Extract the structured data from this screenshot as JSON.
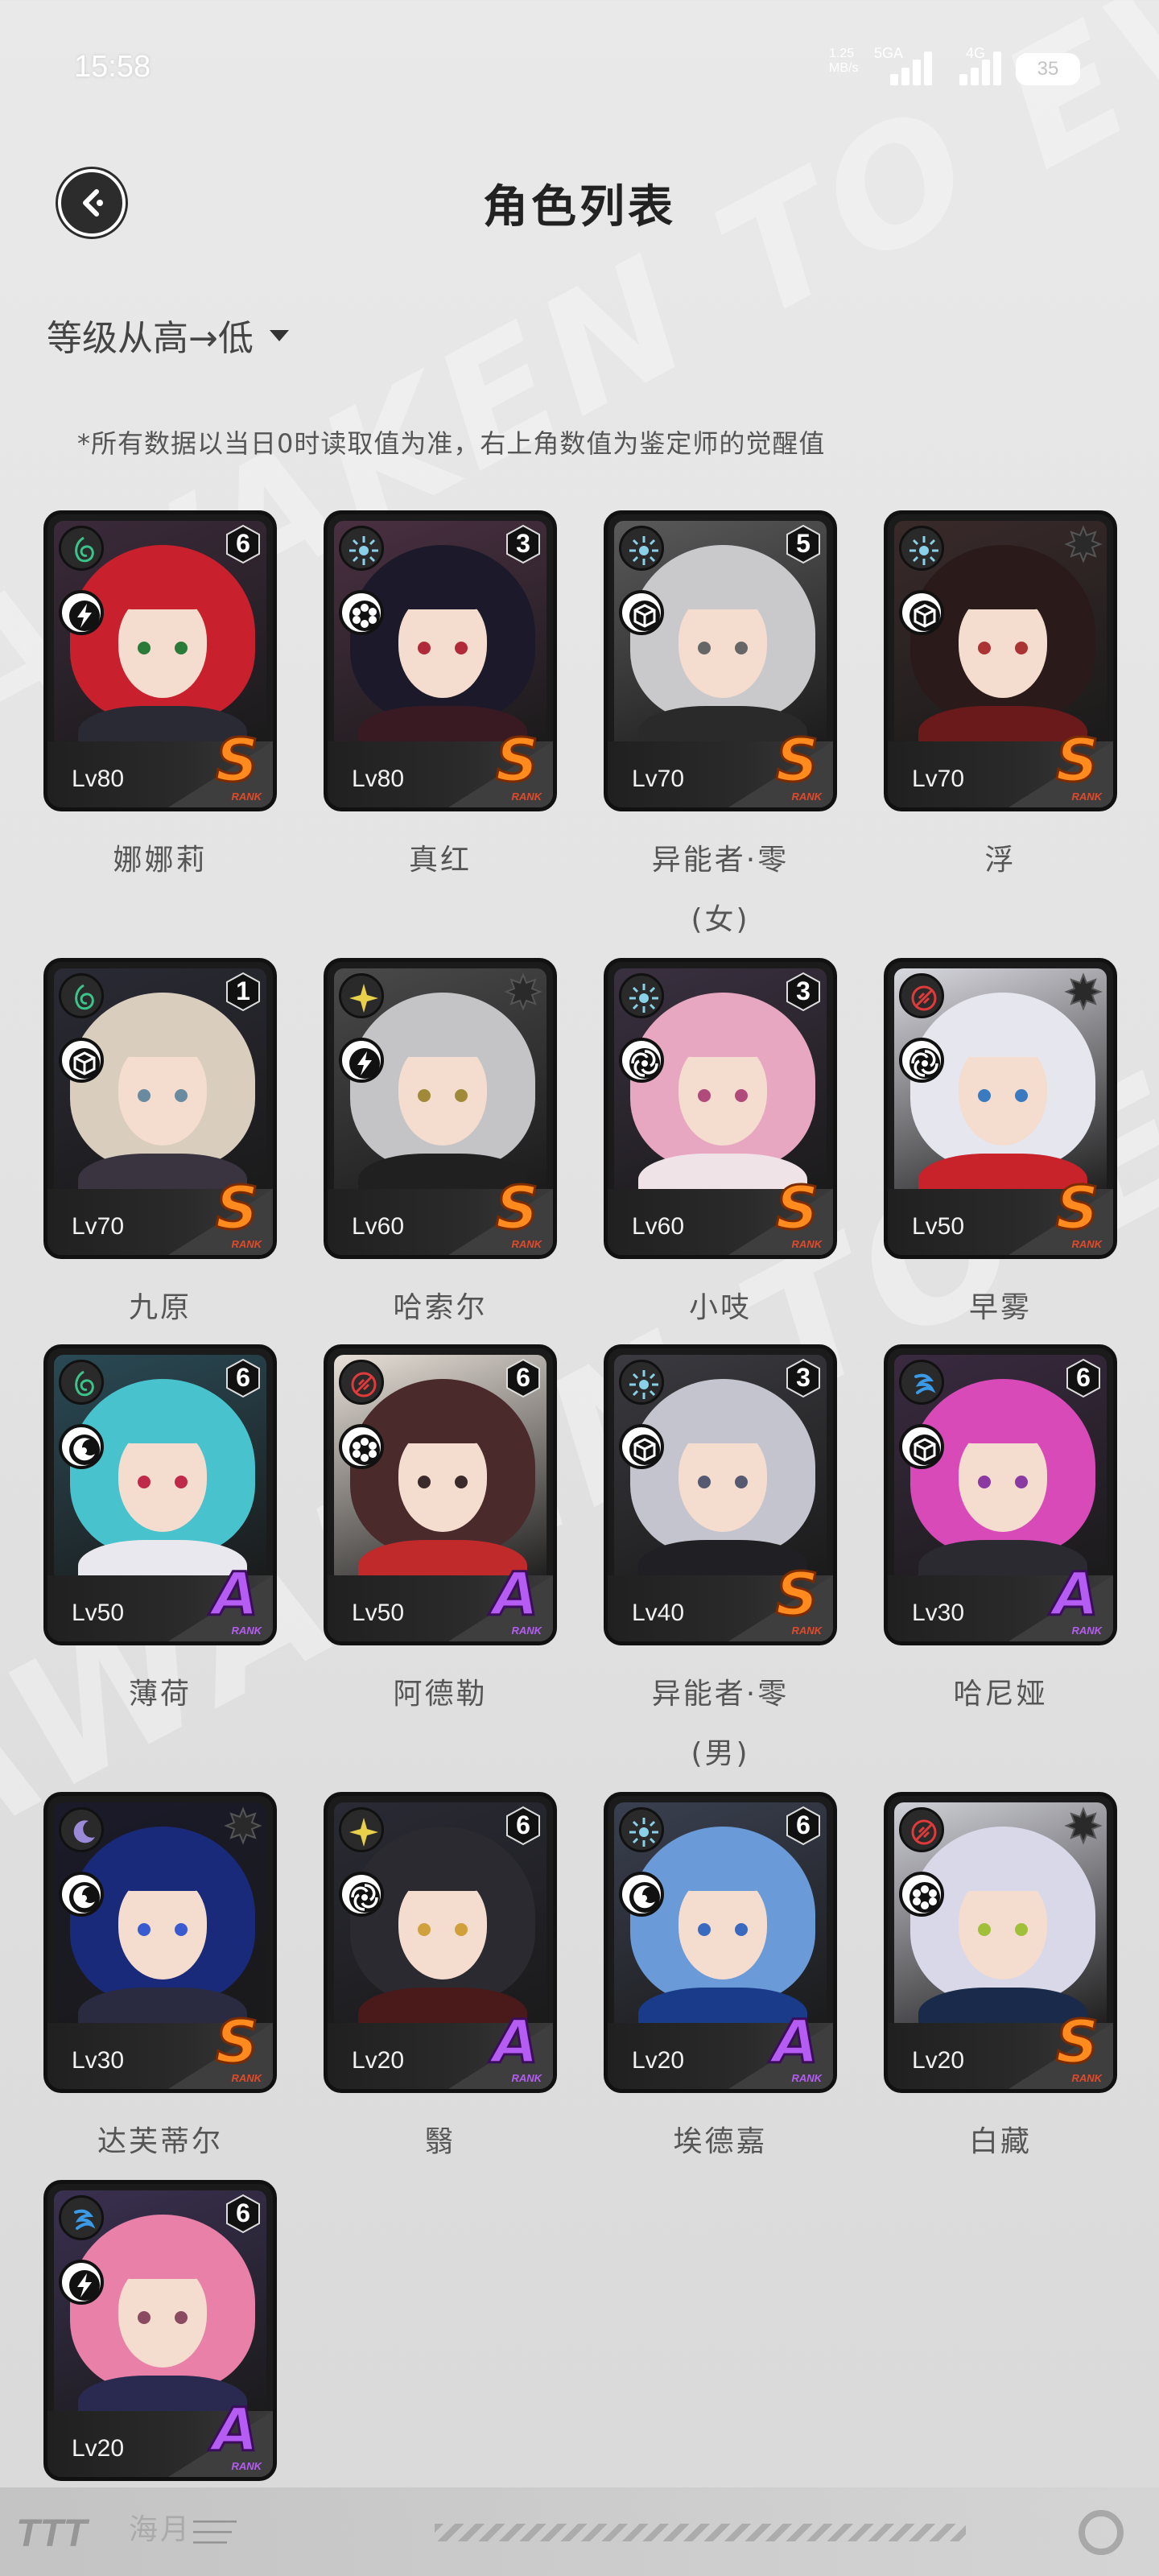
{
  "status_bar": {
    "time": "15:58",
    "net_speed": "1.25",
    "net_unit": "MB/s",
    "sim1_label": "5GA",
    "sim2_label": "4G",
    "battery": "35"
  },
  "header": {
    "title": "角色列表"
  },
  "sort": {
    "label": "等级从高→低"
  },
  "note": "*所有数据以当日0时读取值为准，右上角数值为鉴定师的觉醒值",
  "rank_sub": "RANK",
  "characters": [
    {
      "name": "娜娜莉",
      "level": "Lv80",
      "rank": "S",
      "awakening": "6",
      "attr": "wind",
      "role": "thunder",
      "hair": "#c8202d",
      "outfit": "#2a2a35",
      "eye": "#2a7a3a",
      "bg": "#3b2a3a"
    },
    {
      "name": "真红",
      "level": "Lv80",
      "rank": "S",
      "awakening": "3",
      "attr": "light",
      "role": "flower",
      "hair": "#1c1a2a",
      "outfit": "#3a1a22",
      "eye": "#b02a3a",
      "bg": "#4a3042"
    },
    {
      "name": "异能者·零\n(女)",
      "level": "Lv70",
      "rank": "S",
      "awakening": "5",
      "attr": "light",
      "role": "cube",
      "hair": "#c9c9cc",
      "outfit": "#2a2a2a",
      "eye": "#666",
      "bg": "#5a5a5a"
    },
    {
      "name": "浮",
      "level": "Lv70",
      "rank": "S",
      "awakening": "",
      "attr": "light",
      "role": "cube",
      "hair": "#2a1a1a",
      "outfit": "#6a1a1a",
      "eye": "#a33",
      "bg": "#3a2a2a"
    },
    {
      "name": "九原",
      "level": "Lv70",
      "rank": "S",
      "awakening": "1",
      "attr": "wind",
      "role": "cube",
      "hair": "#d9cdbd",
      "outfit": "#3a3340",
      "eye": "#6a8aa0",
      "bg": "#2a2a35"
    },
    {
      "name": "哈索尔",
      "level": "Lv60",
      "rank": "S",
      "awakening": "",
      "attr": "star",
      "role": "thunder",
      "hair": "#c4c4c6",
      "outfit": "#202020",
      "eye": "#a08a3a",
      "bg": "#4a4a4a"
    },
    {
      "name": "小吱",
      "level": "Lv60",
      "rank": "S",
      "awakening": "3",
      "attr": "light",
      "role": "vortex",
      "hair": "#e8a7c0",
      "outfit": "#efe3e8",
      "eye": "#b04a7a",
      "bg": "#3a3040"
    },
    {
      "name": "早雾",
      "level": "Lv50",
      "rank": "S",
      "awakening": "",
      "attr": "fire",
      "role": "vortex",
      "hair": "#e6e6ef",
      "outfit": "#c8222a",
      "eye": "#3a7ac0",
      "bg": "#d8d8df"
    },
    {
      "name": "薄荷",
      "level": "Lv50",
      "rank": "A",
      "awakening": "6",
      "attr": "wind",
      "role": "moon",
      "hair": "#48c2cc",
      "outfit": "#e8e8ee",
      "eye": "#c02a4a",
      "bg": "#2a4a55"
    },
    {
      "name": "阿德勒",
      "level": "Lv50",
      "rank": "A",
      "awakening": "6",
      "attr": "fire",
      "role": "flower",
      "hair": "#4a2a2a",
      "outfit": "#c02a2a",
      "eye": "#3a2a2a",
      "bg": "#e8e0d8"
    },
    {
      "name": "异能者·零\n(男)",
      "level": "Lv40",
      "rank": "S",
      "awakening": "3",
      "attr": "light",
      "role": "cube",
      "hair": "#c4c4ce",
      "outfit": "#202024",
      "eye": "#555a70",
      "bg": "#3a3a40"
    },
    {
      "name": "哈尼娅",
      "level": "Lv30",
      "rank": "A",
      "awakening": "6",
      "attr": "water",
      "role": "cube",
      "hair": "#d84ab8",
      "outfit": "#2a2a30",
      "eye": "#8a3aa0",
      "bg": "#3a2a40"
    },
    {
      "name": "达芙蒂尔",
      "level": "Lv30",
      "rank": "S",
      "awakening": "",
      "attr": "dark",
      "role": "moon",
      "hair": "#1a2a7a",
      "outfit": "#2a2a40",
      "eye": "#3a5ad0",
      "bg": "#1a1a2a"
    },
    {
      "name": "翳",
      "level": "Lv20",
      "rank": "A",
      "awakening": "6",
      "attr": "star",
      "role": "vortex",
      "hair": "#2a2a30",
      "outfit": "#4a1a1a",
      "eye": "#d0a03a",
      "bg": "#2a2a35"
    },
    {
      "name": "埃德嘉",
      "level": "Lv20",
      "rank": "A",
      "awakening": "6",
      "attr": "light",
      "role": "moon",
      "hair": "#6a9ad8",
      "outfit": "#1a3a8a",
      "eye": "#3a6ac0",
      "bg": "#3a4050"
    },
    {
      "name": "白藏",
      "level": "Lv20",
      "rank": "S",
      "awakening": "",
      "attr": "fire",
      "role": "flower",
      "hair": "#d8d8e8",
      "outfit": "#1a2a4a",
      "eye": "#a0c03a",
      "bg": "#d0d0d8"
    },
    {
      "name": "海月",
      "level": "Lv20",
      "rank": "A",
      "awakening": "6",
      "attr": "water",
      "role": "thunder",
      "hair": "#e880a8",
      "outfit": "#2a2a50",
      "eye": "#8a4a60",
      "bg": "#3a3050"
    }
  ],
  "bottom_bar": {
    "logo": "TTT"
  },
  "colors": {
    "rank_s": "#ff8a1e",
    "rank_a": "#b55cf2",
    "attr_wind": "#3ac48a",
    "attr_light": "#8ad0e8",
    "attr_star": "#e8d04a",
    "attr_fire": "#e03a3a",
    "attr_water": "#3a9ae8",
    "attr_dark": "#9a8ad8"
  }
}
